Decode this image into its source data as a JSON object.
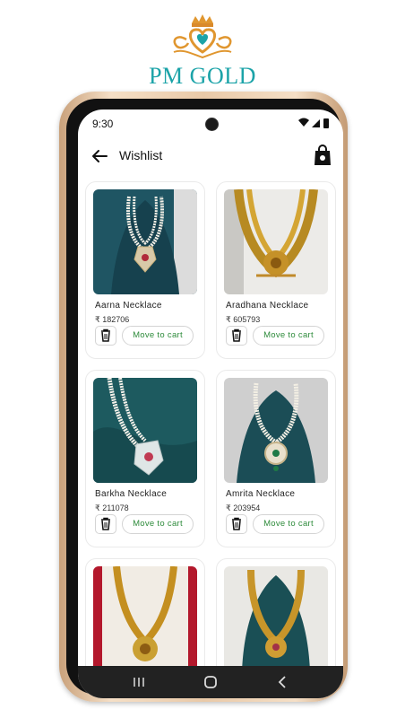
{
  "brand": {
    "name": "PM GOLD",
    "color_primary": "#1ba3a8",
    "color_gold": "#d9892a"
  },
  "status_bar": {
    "time": "9:30",
    "icons": [
      "wifi-icon",
      "signal-icon",
      "battery-icon"
    ]
  },
  "app_bar": {
    "title": "Wishlist",
    "back_icon": "back-arrow-icon",
    "cart_icon": "shopping-bag-icon"
  },
  "wishlist": {
    "remove_icon": "trash-icon",
    "items": [
      {
        "name": "Aarna Necklace",
        "price": "₹ 182706",
        "cta": "Move to cart",
        "image": "pearl-necklace-teal-bust"
      },
      {
        "name": "Aradhana Necklace",
        "price": "₹ 605793",
        "cta": "Move to cart",
        "image": "gold-temple-necklace"
      },
      {
        "name": "Barkha Necklace",
        "price": "₹ 211078",
        "cta": "Move to cart",
        "image": "pearl-necklace-green-cloth"
      },
      {
        "name": "Amrita Necklace",
        "price": "₹ 203954",
        "cta": "Move to cart",
        "image": "pearl-necklace-teal-bust"
      },
      {
        "name": "",
        "price": "",
        "cta": "",
        "image": "gold-long-necklace-red"
      },
      {
        "name": "",
        "price": "",
        "cta": "",
        "image": "gold-necklace-teal-bust"
      }
    ]
  },
  "nav_bar": {
    "buttons": [
      "recents-icon",
      "home-icon",
      "back-icon"
    ]
  },
  "colors": {
    "cta_text": "#2e8b3b",
    "phone_frame": "#e9c9a8"
  }
}
